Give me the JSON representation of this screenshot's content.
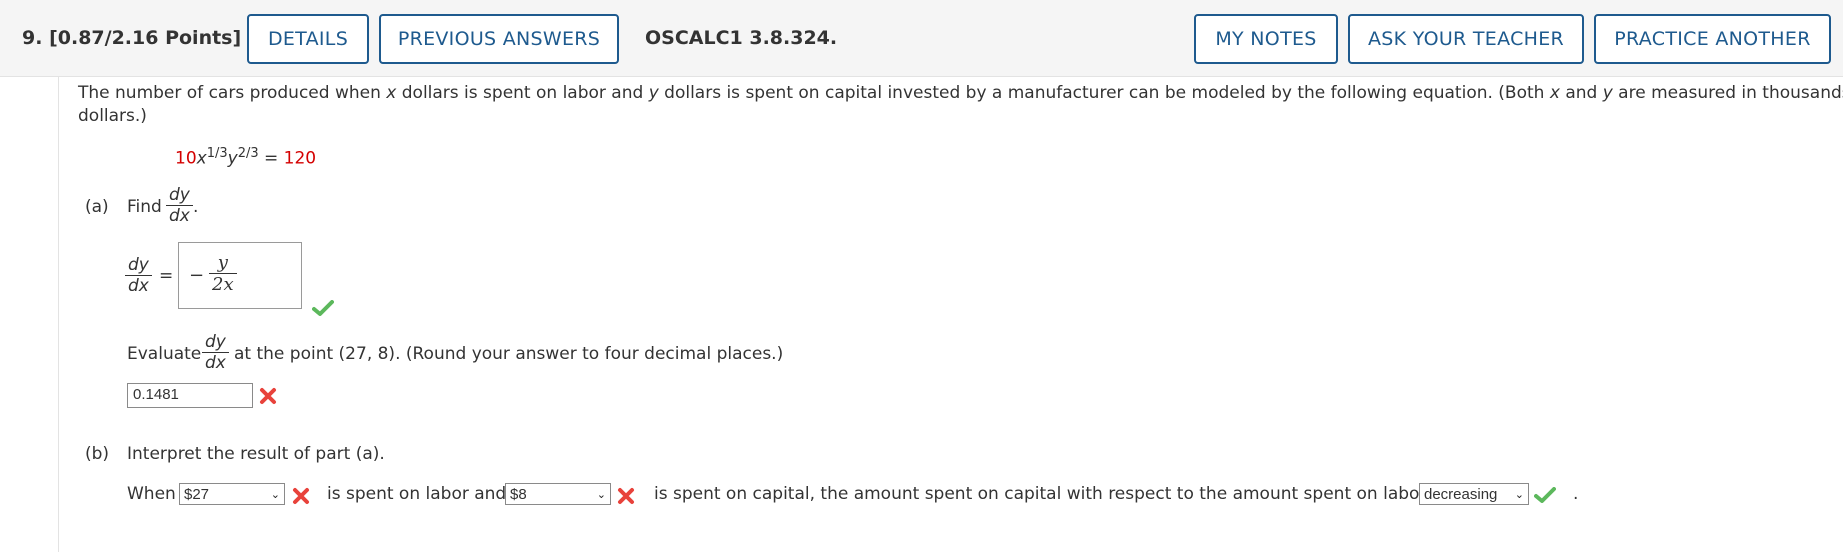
{
  "header": {
    "question_number": "9.",
    "points": "[0.87/2.16 Points]",
    "buttons": {
      "details": "DETAILS",
      "previous_answers": "PREVIOUS ANSWERS",
      "my_notes": "MY NOTES",
      "ask_teacher": "ASK YOUR TEACHER",
      "practice_another": "PRACTICE ANOTHER"
    },
    "problem_code": "OSCALC1 3.8.324."
  },
  "problem": {
    "intro_1": "The number of cars produced when",
    "var_x": "x",
    "intro_2": "dollars is spent on labor and",
    "var_y": "y",
    "intro_3": "dollars is spent on capital invested by a manufacturer can be modeled by the following equation. (Both",
    "intro_4": "and",
    "intro_5": "are measured in thousands of",
    "intro_line2": "dollars.)",
    "equation": {
      "coef": "10",
      "x": "x",
      "x_exp": "1/3",
      "y": "y",
      "y_exp": "2/3",
      "equals": "=",
      "rhs": "120"
    }
  },
  "part_a": {
    "label": "(a)",
    "find": "Find",
    "dy": "dy",
    "dx": "dx",
    "period": ".",
    "equals": "=",
    "answer_sign": "−",
    "answer_num": "y",
    "answer_den": "2x",
    "evaluate_1": "Evaluate",
    "evaluate_2": "at the point (27, 8). (Round your answer to four decimal places.)",
    "evaluate_value": "0.1481"
  },
  "part_b": {
    "label": "(b)",
    "prompt": "Interpret the result of part (a).",
    "when": "When",
    "select_1": "$27",
    "mid_1": "is spent on labor and",
    "select_2": "$8",
    "mid_2": "is spent on capital, the amount spent on capital with respect to the amount spent on labor is",
    "select_3": "decreasing",
    "end": "."
  },
  "colors": {
    "accent": "#1e5a8e",
    "correct": "#5cb85c",
    "incorrect": "#e8423b",
    "equation_red": "#d40000"
  }
}
